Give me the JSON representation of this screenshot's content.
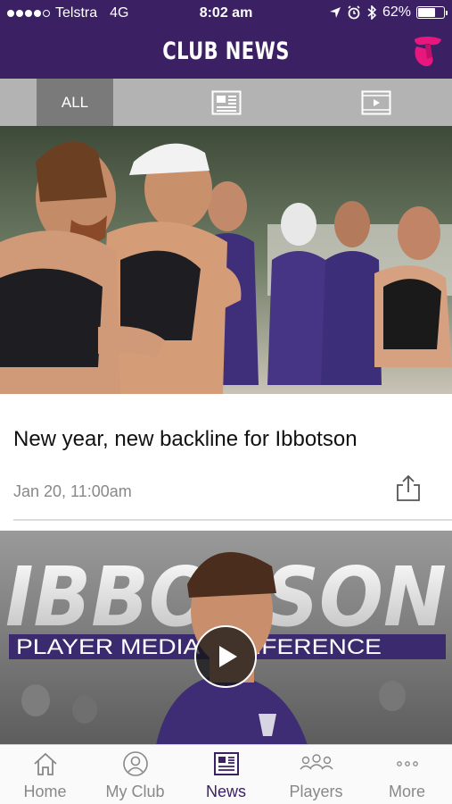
{
  "status_bar": {
    "carrier": "Telstra",
    "network": "4G",
    "time": "8:02 am",
    "battery_percent": "62%",
    "battery_level": 0.62,
    "signal_bars_filled": 4,
    "signal_bars_total": 5
  },
  "header": {
    "title": "CLUB NEWS",
    "logo_icon": "telstra-logo-icon",
    "background_color": "#3b2063",
    "logo_color": "#e8177d"
  },
  "filters": {
    "all_label": "ALL",
    "articles_icon": "article-icon",
    "videos_icon": "video-icon",
    "selected": "ALL"
  },
  "news": [
    {
      "title": "New year, new backline for Ibbotson",
      "timestamp": "Jan 20, 11:00am",
      "share_icon": "share-icon"
    },
    {
      "banner_word": "IBBOTSON",
      "banner_subtitle": "PLAYER MEDIA CONFERENCE",
      "play_icon": "play-icon"
    }
  ],
  "tabbar": {
    "items": [
      {
        "label": "Home",
        "icon": "home-icon"
      },
      {
        "label": "My Club",
        "icon": "user-icon"
      },
      {
        "label": "News",
        "icon": "news-icon"
      },
      {
        "label": "Players",
        "icon": "players-icon"
      },
      {
        "label": "More",
        "icon": "more-icon"
      }
    ],
    "active": "News",
    "active_color": "#3b2063"
  }
}
